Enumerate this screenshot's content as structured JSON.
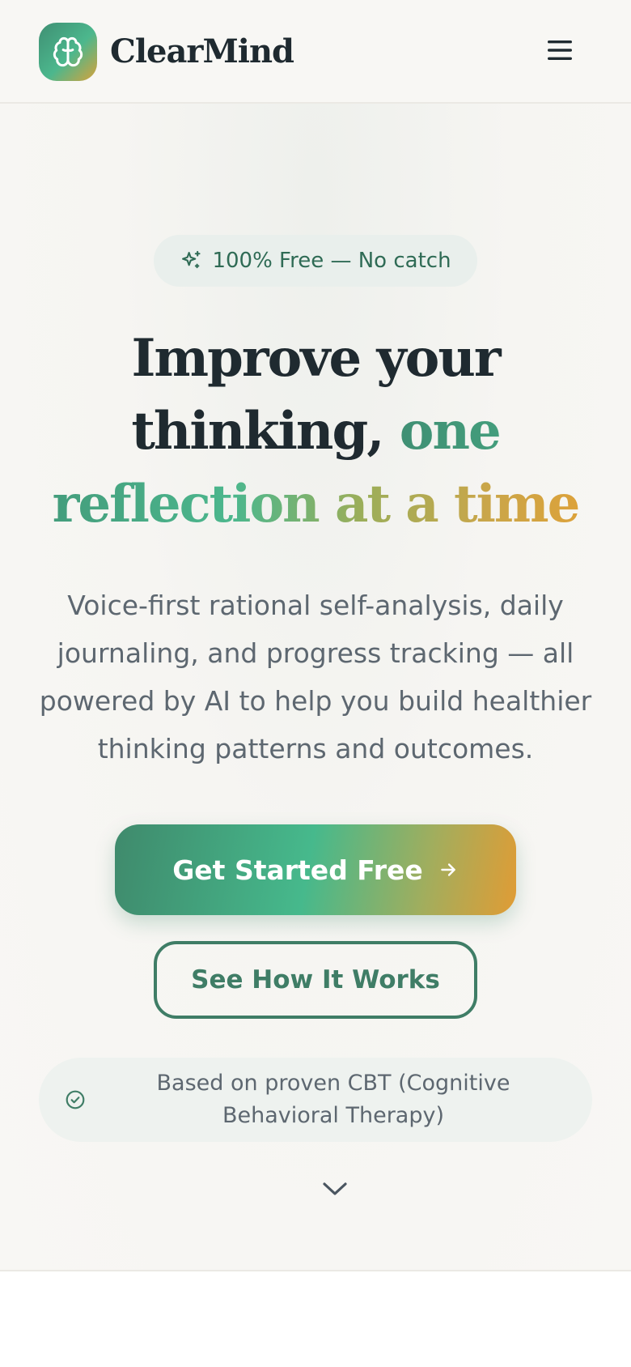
{
  "header": {
    "brand": "ClearMind",
    "logo_icon": "brain-icon",
    "menu_icon": "hamburger-menu-icon"
  },
  "hero": {
    "badge": {
      "icon": "sparkles-icon",
      "text": "100% Free — No catch"
    },
    "headline": {
      "plain": "Improve your thinking,",
      "highlight": "one reflection at a time"
    },
    "subtext": "Voice-first rational self-analysis, daily journaling, and progress tracking — all powered by AI to help you build healthier thinking patterns and outcomes.",
    "primary_cta": {
      "label": "Get Started Free",
      "icon": "arrow-right-icon"
    },
    "secondary_cta": {
      "label": "See How It Works"
    },
    "note": {
      "icon": "check-circle-icon",
      "text": "Based on proven CBT (Cognitive Behavioral Therapy)"
    },
    "scroll_icon": "chevron-down-icon"
  },
  "colors": {
    "brand_green": "#3f8f73",
    "brand_gold": "#dca23a",
    "text_dark": "#1f2a30",
    "text_muted": "#5d6770",
    "background": "#f8f7f4"
  }
}
